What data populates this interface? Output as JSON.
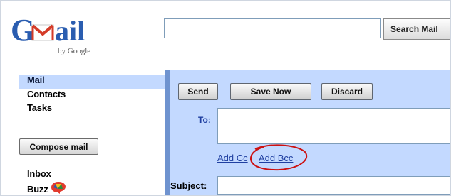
{
  "header": {
    "logo_text": "Gmail",
    "logo_sub": "by Google",
    "search_value": "",
    "search_button": "Search Mail"
  },
  "sidebar": {
    "items_top": [
      {
        "label": "Mail",
        "selected": true
      },
      {
        "label": "Contacts"
      },
      {
        "label": "Tasks"
      }
    ],
    "compose_button": "Compose mail",
    "folders": [
      {
        "label": "Inbox"
      },
      {
        "label": "Buzz",
        "icon": "buzz-icon"
      }
    ]
  },
  "compose": {
    "buttons": {
      "send": "Send",
      "save_now": "Save Now",
      "discard": "Discard"
    },
    "to_label": "To:",
    "to_value": "",
    "add_cc": "Add Cc",
    "add_bcc": "Add Bcc",
    "subject_label": "Subject:",
    "subject_value": ""
  },
  "colors": {
    "panel_bg": "#c3d9ff",
    "panel_border": "#6f93cf",
    "link": "#1f3fa1",
    "annotation_circle": "#cc1111"
  }
}
